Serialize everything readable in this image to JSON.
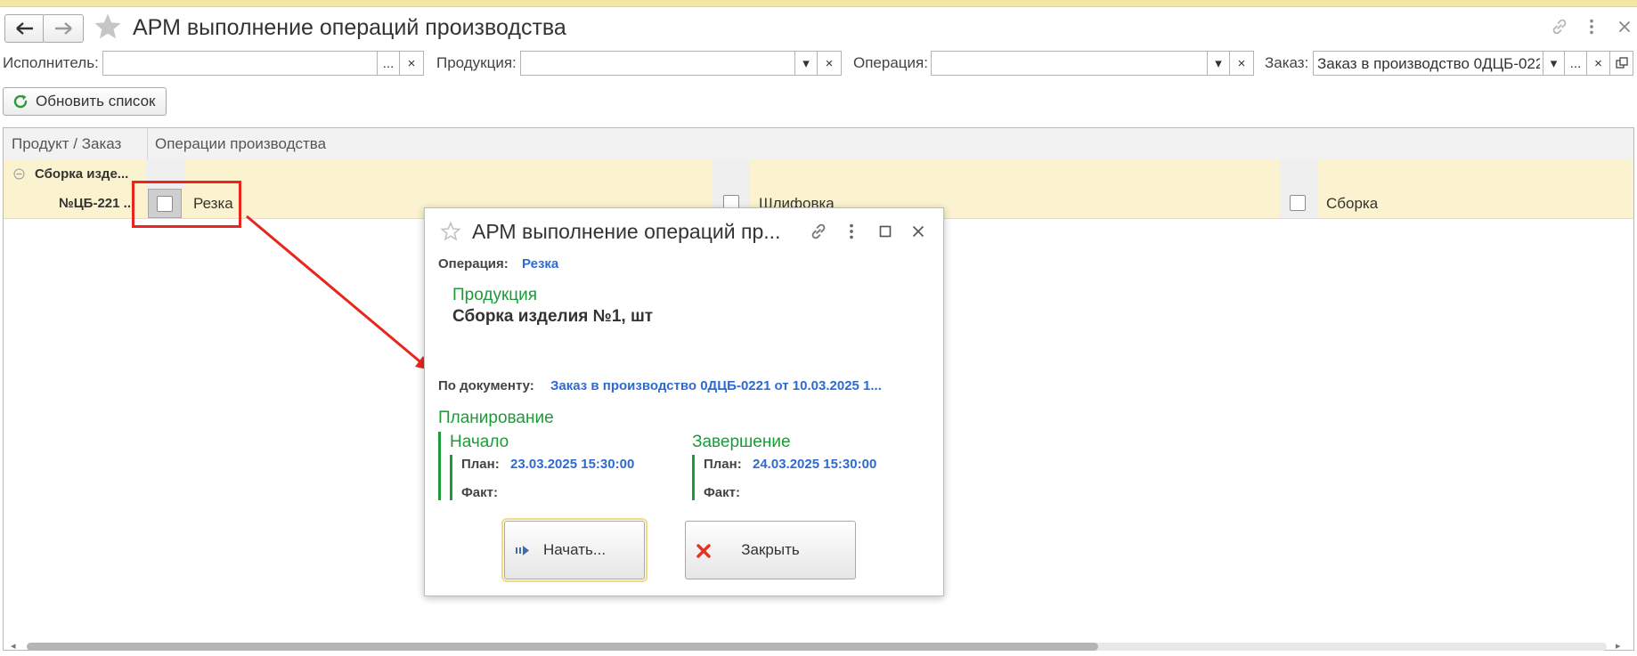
{
  "window": {
    "title": "АРМ выполнение операций производства"
  },
  "filters": {
    "executor_label": "Исполнитель:",
    "executor_value": "",
    "product_label": "Продукция:",
    "product_value": "",
    "operation_label": "Операция:",
    "operation_value": "",
    "order_label": "Заказ:",
    "order_value": "Заказ в производство 0ДЦБ-022",
    "select_button": "...",
    "clear_button": "×",
    "dropdown_button": "▾"
  },
  "toolbar": {
    "refresh_label": "Обновить список"
  },
  "grid": {
    "columns": [
      "Продукт / Заказ",
      "Операции производства"
    ],
    "group_label": "Сборка изде...",
    "order_label": "№ЦБ-221 ...",
    "operations": [
      {
        "name": "Резка"
      },
      {
        "name": "Шлифовка"
      },
      {
        "name": "Сборка"
      }
    ]
  },
  "popup": {
    "title": "АРМ выполнение операций пр...",
    "operation_label": "Операция:",
    "operation_value": "Резка",
    "product_header": "Продукция",
    "product_value": "Сборка изделия №1, шт",
    "document_label": "По документу:",
    "document_value": "Заказ в производство 0ДЦБ-0221 от 10.03.2025 1...",
    "planning_header": "Планирование",
    "start_header": "Начало",
    "end_header": "Завершение",
    "plan_label": "План:",
    "fact_label": "Факт:",
    "start_plan": "23.03.2025 15:30:00",
    "end_plan": "24.03.2025 15:30:00",
    "start_button": "Начать...",
    "close_button": "Закрыть"
  },
  "colors": {
    "accent_link": "#2e6bd1",
    "section_green": "#1d9a3a",
    "row_highlight": "#fbf3cf",
    "callout_red": "#e8261c"
  }
}
